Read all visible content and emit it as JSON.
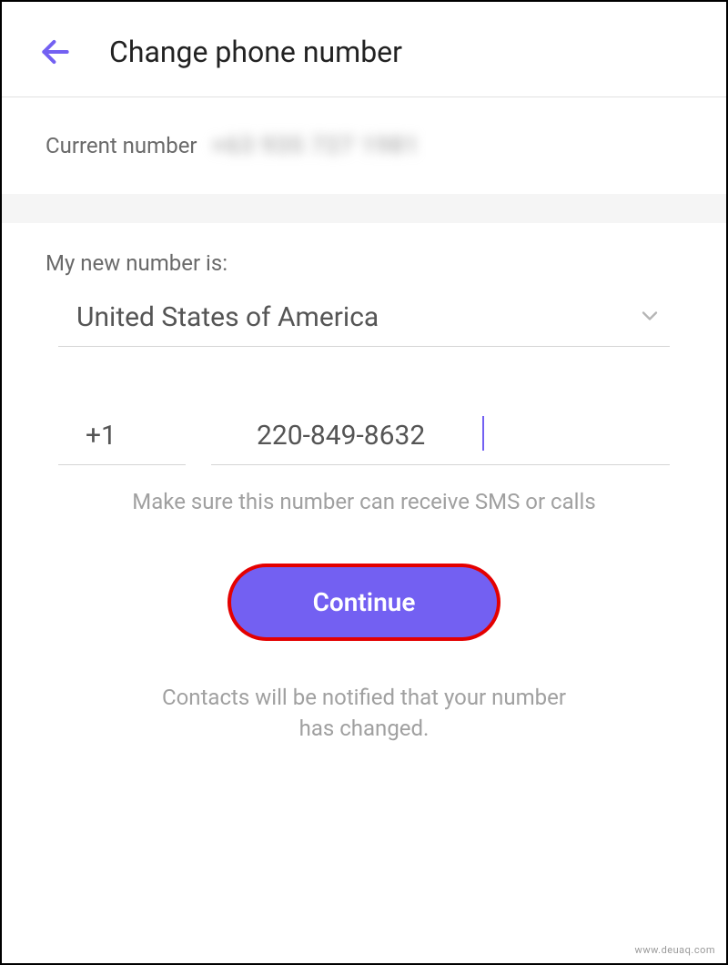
{
  "header": {
    "title": "Change phone number"
  },
  "current": {
    "label": "Current number",
    "masked_value": "+63 935 727 1981"
  },
  "new_number": {
    "label": "My new number is:",
    "country": "United States of America",
    "dial_code": "+1",
    "phone_value": "220-849-8632",
    "hint": "Make sure this number can receive SMS or calls"
  },
  "actions": {
    "continue_label": "Continue"
  },
  "notify_text": "Contacts will be notified that your number has changed.",
  "watermark": "www.deuaq.com"
}
